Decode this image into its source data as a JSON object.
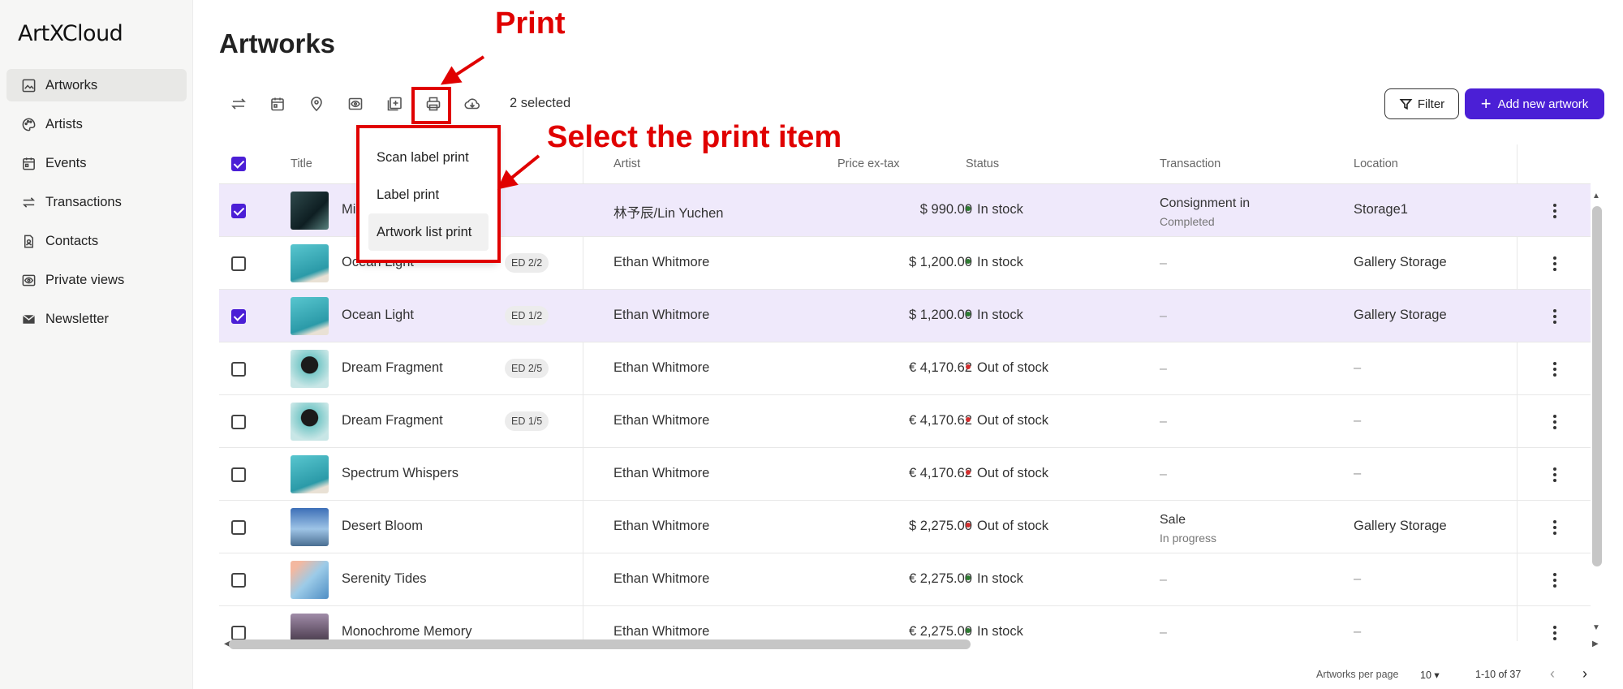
{
  "app": {
    "logo": "ArtXCloud"
  },
  "sidebar": {
    "items": [
      {
        "label": "Artworks",
        "icon": "image-icon"
      },
      {
        "label": "Artists",
        "icon": "palette-icon"
      },
      {
        "label": "Events",
        "icon": "calendar-icon"
      },
      {
        "label": "Transactions",
        "icon": "transfer-icon"
      },
      {
        "label": "Contacts",
        "icon": "contact-icon"
      },
      {
        "label": "Private views",
        "icon": "eye-icon"
      },
      {
        "label": "Newsletter",
        "icon": "mail-icon"
      }
    ]
  },
  "page": {
    "title": "Artworks"
  },
  "toolbar": {
    "selected_text": "2 selected",
    "filter_label": "Filter",
    "add_label": "Add new artwork"
  },
  "dropdown": {
    "items": [
      "Scan label print",
      "Label print",
      "Artwork list print"
    ]
  },
  "table": {
    "headers": {
      "title": "Title",
      "artist": "Artist",
      "price": "Price ex-tax",
      "status": "Status",
      "transaction": "Transaction",
      "location": "Location"
    },
    "rows": [
      {
        "selected": true,
        "title": "Mi",
        "edition": "",
        "artist": "林予辰/Lin Yuchen",
        "price": "$  990.00",
        "status": "In stock",
        "status_color": "#2e7d32",
        "transaction": "Consignment in",
        "transaction_sub": "Completed",
        "location": "Storage1"
      },
      {
        "selected": false,
        "title": "Ocean Light",
        "edition": "ED 2/2",
        "artist": "Ethan Whitmore",
        "price": "$  1,200.00",
        "status": "In stock",
        "status_color": "#2e7d32",
        "transaction": "–",
        "transaction_sub": "",
        "location": "Gallery Storage"
      },
      {
        "selected": true,
        "title": "Ocean Light",
        "edition": "ED 1/2",
        "artist": "Ethan Whitmore",
        "price": "$  1,200.00",
        "status": "In stock",
        "status_color": "#2e7d32",
        "transaction": "–",
        "transaction_sub": "",
        "location": "Gallery Storage"
      },
      {
        "selected": false,
        "title": "Dream Fragment",
        "edition": "ED 2/5",
        "artist": "Ethan Whitmore",
        "price": "€  4,170.62",
        "status": "Out of stock",
        "status_color": "#d32f2f",
        "transaction": "–",
        "transaction_sub": "",
        "location": "–"
      },
      {
        "selected": false,
        "title": "Dream Fragment",
        "edition": "ED 1/5",
        "artist": "Ethan Whitmore",
        "price": "€  4,170.62",
        "status": "Out of stock",
        "status_color": "#d32f2f",
        "transaction": "–",
        "transaction_sub": "",
        "location": "–"
      },
      {
        "selected": false,
        "title": "Spectrum Whispers",
        "edition": "",
        "artist": "Ethan Whitmore",
        "price": "€  4,170.62",
        "status": "Out of stock",
        "status_color": "#d32f2f",
        "transaction": "–",
        "transaction_sub": "",
        "location": "–"
      },
      {
        "selected": false,
        "title": "Desert Bloom",
        "edition": "",
        "artist": "Ethan Whitmore",
        "price": "$  2,275.00",
        "status": "Out of stock",
        "status_color": "#d32f2f",
        "transaction": "Sale",
        "transaction_sub": "In progress",
        "location": "Gallery Storage"
      },
      {
        "selected": false,
        "title": "Serenity Tides",
        "edition": "",
        "artist": "Ethan Whitmore",
        "price": "€  2,275.00",
        "status": "In stock",
        "status_color": "#2e7d32",
        "transaction": "–",
        "transaction_sub": "",
        "location": "–"
      },
      {
        "selected": false,
        "title": "Monochrome Memory",
        "edition": "",
        "artist": "Ethan Whitmore",
        "price": "€  2,275.00",
        "status": "In stock",
        "status_color": "#2e7d32",
        "transaction": "–",
        "transaction_sub": "",
        "location": "–"
      }
    ]
  },
  "pagination": {
    "per_page_label": "Artworks per page",
    "per_page_value": "10",
    "range": "1-10 of 37"
  },
  "annotations": {
    "print_label": "Print",
    "select_label": "Select the print item"
  },
  "colors": {
    "accent": "#4b1fd6",
    "annotation": "#e00000",
    "selected_row": "#efe9fb"
  }
}
